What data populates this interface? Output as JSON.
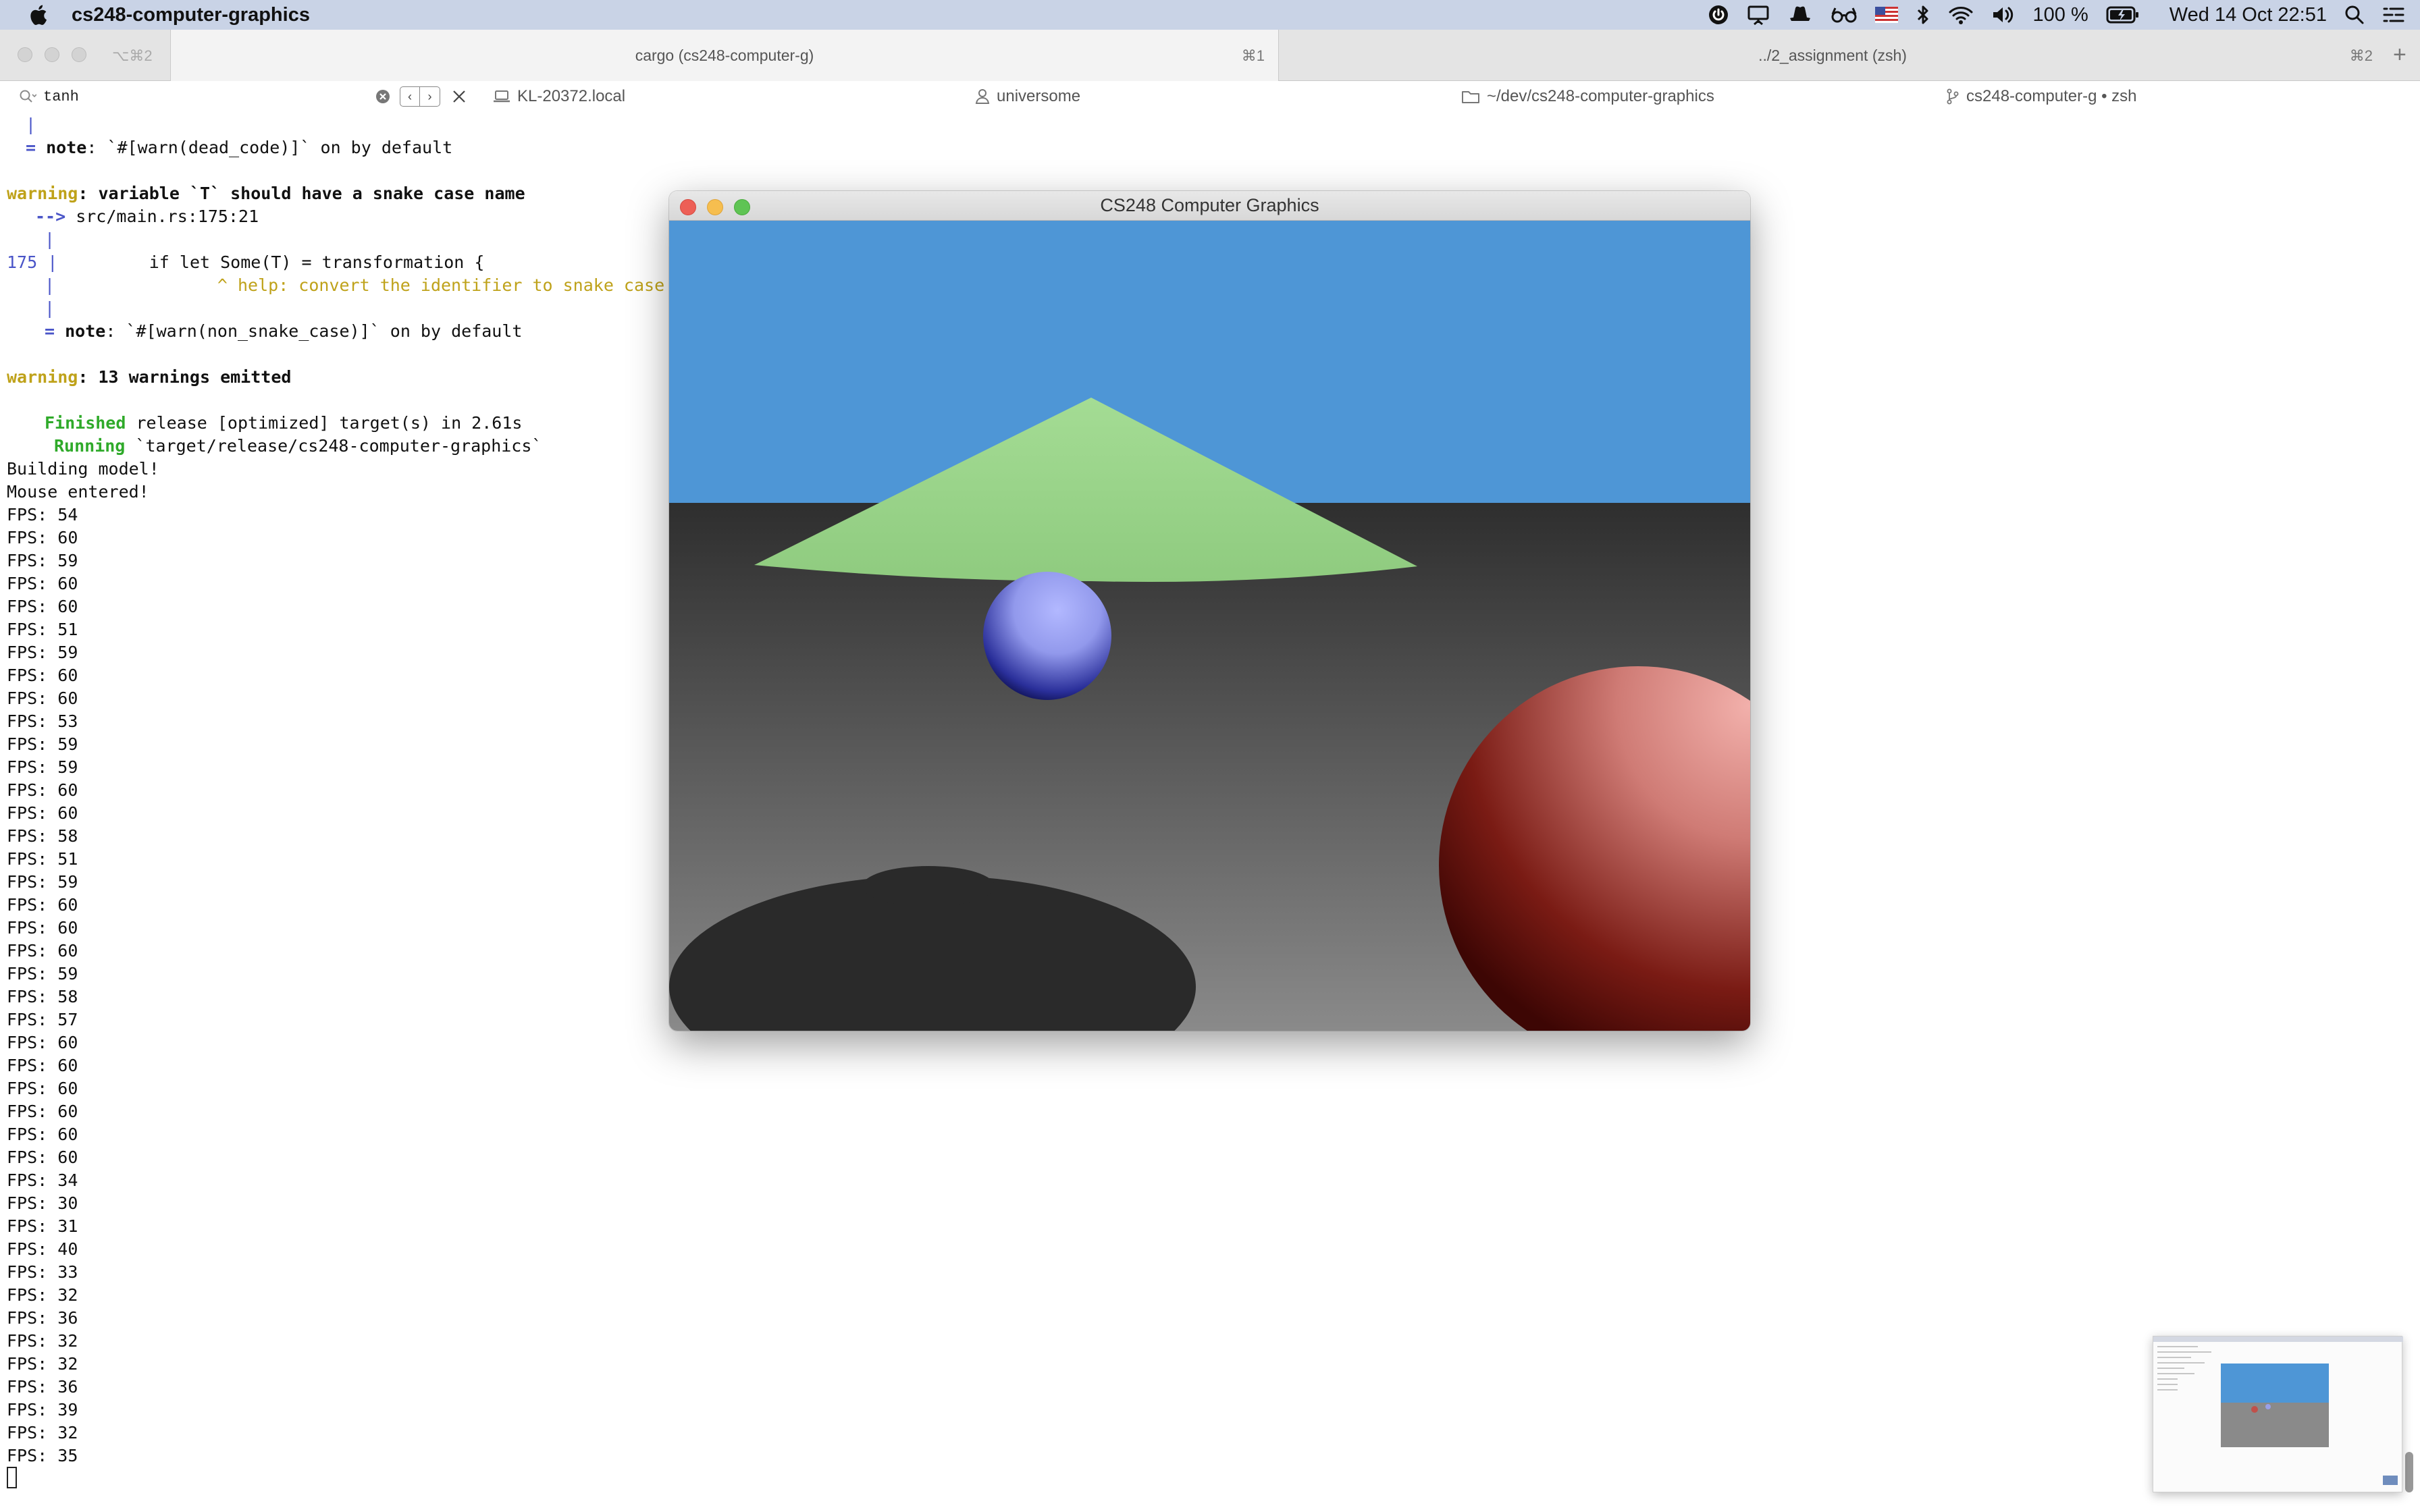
{
  "menubar": {
    "app_name": "cs248-computer-graphics",
    "battery": "100 %",
    "datetime": "Wed 14 Oct  22:51"
  },
  "tabbar": {
    "window_shortcut": "⌥⌘2",
    "tabs": [
      {
        "label": "cargo (cs248-computer-g)",
        "shortcut": "⌘1"
      },
      {
        "label": "../2_assignment (zsh)",
        "shortcut": "⌘2"
      }
    ],
    "new_tab": "+"
  },
  "infobar": {
    "search_value": "tanh",
    "host": "KL-20372.local",
    "user": "universome",
    "path": "~/dev/cs248-computer-graphics",
    "session": "cs248-computer-g • zsh"
  },
  "terminal": {
    "line_gutter": "|",
    "line_note1_eq": "=",
    "line_note1_label": "note",
    "line_note1_text": ": `#[warn(dead_code)]` on by default",
    "warn1_label": "warning",
    "warn1_text": ": variable `T` should have a snake case name",
    "arrow": "-->",
    "location": " src/main.rs:175:21",
    "gutter_bar": "|",
    "line_no": "175",
    "code": "        if let Some(T) = transformation {",
    "help": "                ^ help: convert the identifier to snake case",
    "note2_eq": "=",
    "note2_label": "note",
    "note2_text": ": `#[warn(non_snake_case)]` on by default",
    "warn2_label": "warning",
    "warn2_text": ": 13 warnings emitted",
    "finished_label": "Finished",
    "finished_text": " release [optimized] target(s) in 2.61s",
    "running_label": "Running",
    "running_text": " `target/release/cs248-computer-graphics`",
    "building": "Building model!",
    "mouse": "Mouse entered!",
    "fps_prefix": "FPS: ",
    "fps_values": [
      54,
      60,
      59,
      60,
      60,
      51,
      59,
      60,
      60,
      53,
      59,
      59,
      60,
      60,
      58,
      51,
      59,
      60,
      60,
      60,
      59,
      58,
      57,
      60,
      60,
      60,
      60,
      60,
      60,
      34,
      30,
      31,
      40,
      33,
      32,
      36,
      32,
      32,
      36,
      39,
      32,
      35
    ]
  },
  "gl_window": {
    "title": "CS248 Computer Graphics",
    "colors": {
      "sky": "#4e96d6",
      "cone": "#9ed68e",
      "blue_sphere": "#a6adf5",
      "red_sphere": "#e8a6a2",
      "floor_top": "#2e2e2e",
      "floor_bottom": "#8a8a8a"
    }
  }
}
